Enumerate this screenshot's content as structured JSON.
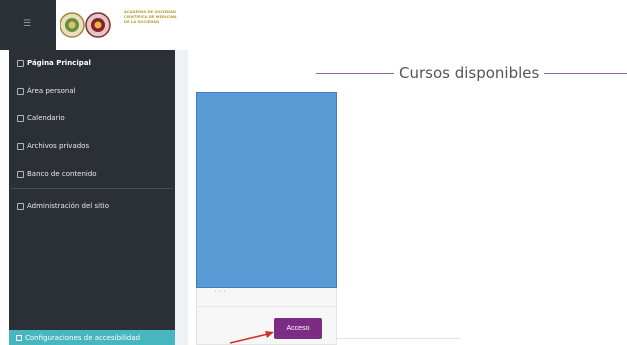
{
  "header": {
    "menu_icon": "hamburger-icon",
    "logo_lines": [
      "ACADEMIA DE SOCIEDAD",
      "CIENTÍFICA DE MEDICINA",
      "DE LA SOCIEDAD"
    ]
  },
  "sidebar": {
    "items": [
      {
        "label": "Página Principal",
        "icon": "home-icon",
        "active": true
      },
      {
        "label": "Área personal",
        "icon": "dashboard-icon"
      },
      {
        "label": "Calendario",
        "icon": "calendar-icon"
      },
      {
        "label": "Archivos privados",
        "icon": "file-icon"
      },
      {
        "label": "Banco de contenido",
        "icon": "content-bank-icon"
      },
      {
        "label": "Administración del sitio",
        "icon": "admin-icon"
      }
    ],
    "bottom": {
      "label": "Configuraciones de accesibilidad",
      "icon": "accessibility-icon"
    }
  },
  "main": {
    "section_title": "Cursos disponibles",
    "course": {
      "button_label": "Acceso",
      "image_color": "#5b9bd5"
    }
  },
  "colors": {
    "sidebar_bg": "#2b3036",
    "accent": "#7b2d83",
    "access_bar": "#47b6bf",
    "title_line": "#8e6a9c",
    "arrow": "#d0302a"
  }
}
